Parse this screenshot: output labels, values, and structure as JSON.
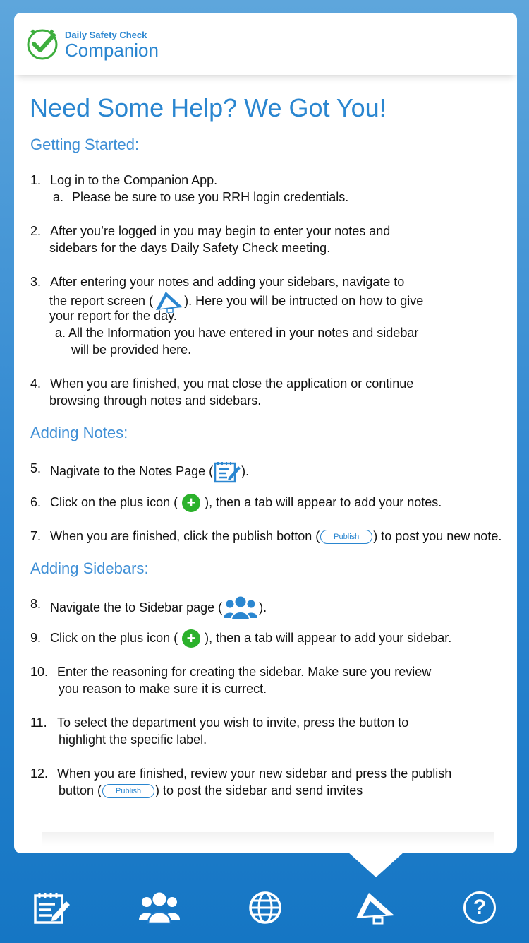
{
  "header": {
    "app_name_small": "Daily Safety Check",
    "app_name_big": "Companion"
  },
  "page_title": "Need Some Help? We Got You!",
  "sections": {
    "getting_started": "Getting Started:",
    "adding_notes": "Adding Notes:",
    "adding_sidebars": "Adding Sidebars:"
  },
  "steps": {
    "s1": {
      "num": "1.",
      "text": "Log in to the Companion App.",
      "sub_label": "a.",
      "sub_text": "Please be sure to use you RRH login credentials."
    },
    "s2": {
      "num": "2.",
      "line1": "After you’re logged in you may begin to enter your notes and",
      "line2": "sidebars for the days Daily Safety Check meeting."
    },
    "s3": {
      "num": "3.",
      "line1": "After entering your notes and adding your sidebars, navigate to",
      "line2_pre": "the report screen (",
      "line2_post": "). Here you will be intructed on how to give",
      "line3": "your report for the day.",
      "sub_line1": "a. All the Information you have entered in your notes and sidebar",
      "sub_line2": "will be provided here."
    },
    "s4": {
      "num": "4.",
      "line1": "When you are finished, you mat close the application or continue",
      "line2": "browsing through notes and sidebars."
    },
    "s5": {
      "num": "5.",
      "pre": "Nagivate to the Notes Page (",
      "post": ")."
    },
    "s6": {
      "num": "6.",
      "pre": "Click on the plus icon (",
      "post": "), then a tab will appear to add your notes."
    },
    "s7": {
      "num": "7.",
      "pre": "When you are finished, click the publish botton (",
      "post": ") to post you new note.",
      "button": "Publish"
    },
    "s8": {
      "num": "8.",
      "pre": "Navigate the to Sidebar page (",
      "post": ")."
    },
    "s9": {
      "num": "9.",
      "pre": "Click on the plus icon (",
      "post": "), then a tab will appear to add your sidebar."
    },
    "s10": {
      "num": "10.",
      "line1": "Enter the reasoning for creating the sidebar. Make sure you review",
      "line2": "you reason to make sure it is currect."
    },
    "s11": {
      "num": "11.",
      "line1": "To select the department you wish to invite, press the button to",
      "line2": "highlight the specific label."
    },
    "s12": {
      "num": "12.",
      "line1": "When you are finished, review your new sidebar and press the publish",
      "line2_pre": "button (",
      "line2_post": ") to post the sidebar and send invites",
      "button": "Publish"
    }
  },
  "plus_glyph": "+",
  "nav": {
    "items": [
      "notes-icon",
      "people-icon",
      "globe-icon",
      "megaphone-icon",
      "help-icon"
    ],
    "help_glyph": "?",
    "active": "megaphone-icon"
  },
  "colors": {
    "accent": "#2a86d0",
    "plus_green": "#2bb12b",
    "logo_green": "#3dae3d"
  }
}
